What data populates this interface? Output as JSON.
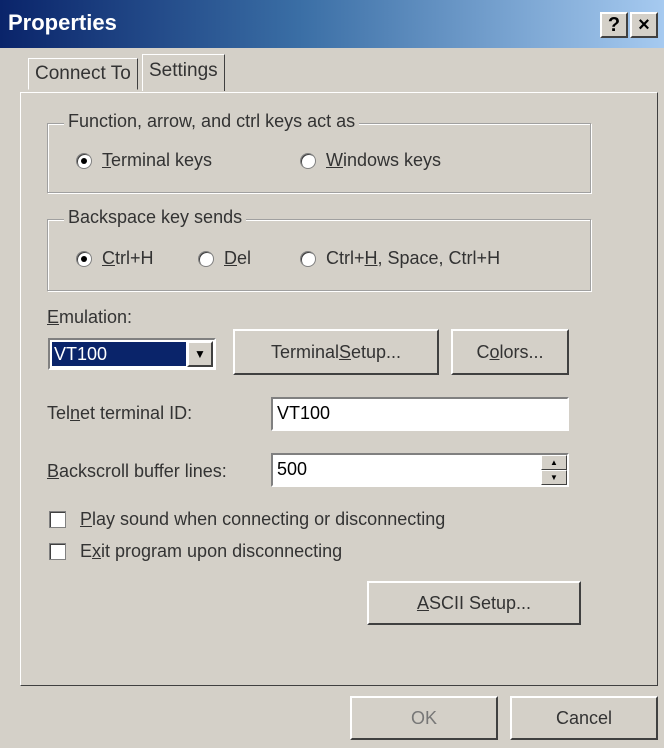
{
  "window": {
    "title": "Properties",
    "help_label": "?",
    "close_label": "×"
  },
  "tabs": [
    {
      "label": "Connect To"
    },
    {
      "label": "Settings"
    }
  ],
  "function_keys_group": {
    "legend": "Function, arrow, and ctrl keys act as",
    "terminal_keys": {
      "pre": "",
      "u": "T",
      "post": "erminal keys"
    },
    "windows_keys": {
      "pre": "",
      "u": "W",
      "post": "indows keys"
    }
  },
  "backspace_group": {
    "legend": "Backspace key sends",
    "ctrl_h": {
      "pre": "",
      "u": "C",
      "post": "trl+H"
    },
    "del": {
      "pre": "",
      "u": "D",
      "post": "el"
    },
    "ctrl_h_space": {
      "pre": "Ctrl+",
      "u": "H",
      "post": ", Space, Ctrl+H"
    }
  },
  "emulation": {
    "label": {
      "pre": "",
      "u": "E",
      "post": "mulation:"
    },
    "value": "VT100",
    "dropdown_glyph": "▼"
  },
  "buttons": {
    "terminal_setup": {
      "pre": "Terminal ",
      "u": "S",
      "post": "etup..."
    },
    "colors": {
      "pre": "C",
      "u": "o",
      "post": "lors..."
    },
    "ascii_setup": {
      "pre": "",
      "u": "A",
      "post": "SCII Setup..."
    },
    "ok": "OK",
    "cancel": "Cancel"
  },
  "telnet_id": {
    "label": {
      "pre": "Tel",
      "u": "n",
      "post": "et terminal ID:"
    },
    "value": "VT100"
  },
  "backscroll": {
    "label": {
      "pre": "",
      "u": "B",
      "post": "ackscroll buffer lines:"
    },
    "value": "500"
  },
  "checkboxes": {
    "play_sound": {
      "pre": "",
      "u": "P",
      "post": "lay sound when connecting or disconnecting"
    },
    "exit_program": {
      "pre": "E",
      "u": "x",
      "post": "it program upon disconnecting"
    }
  }
}
